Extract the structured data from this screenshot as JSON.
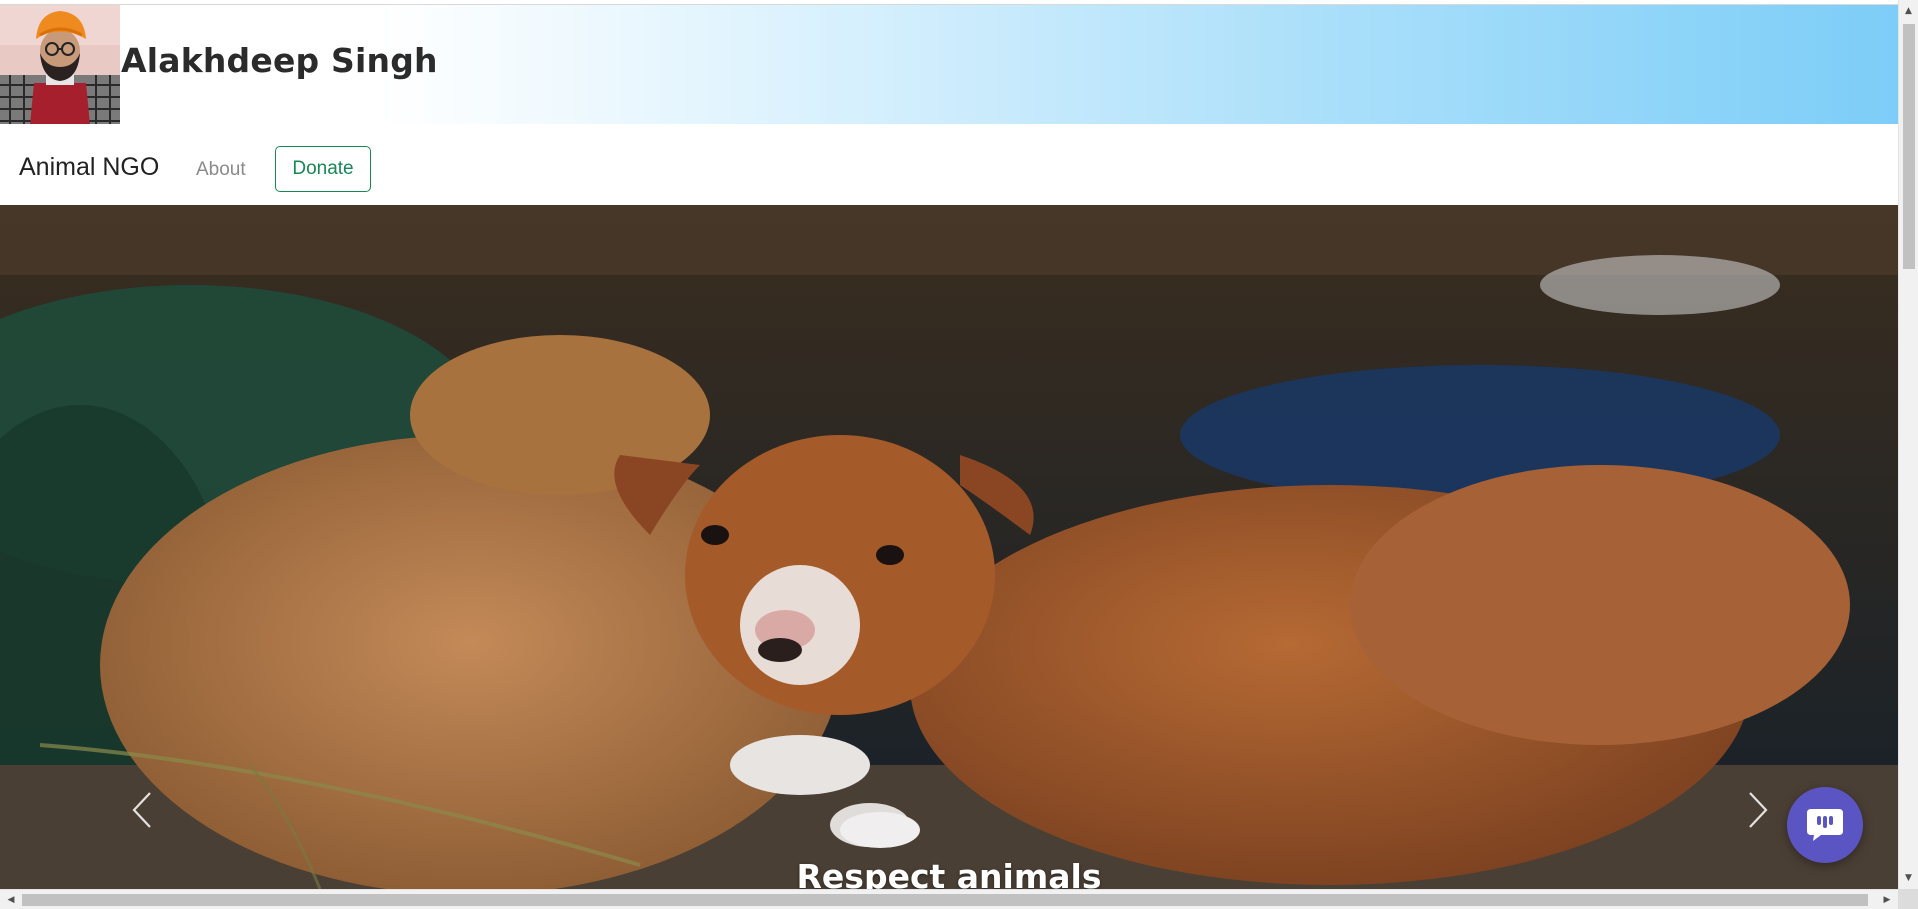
{
  "header": {
    "title": "Alakhdeep Singh",
    "avatar_icon": "profile-photo"
  },
  "navbar": {
    "brand": "Animal NGO",
    "links": [
      {
        "label": "About"
      }
    ],
    "donate_label": "Donate",
    "accent_color": "#198754"
  },
  "carousel": {
    "caption": "Respect animals",
    "prev_icon": "chevron-left-icon",
    "next_icon": "chevron-right-icon"
  },
  "chat_widget": {
    "icon": "chat-bubble-icon",
    "color": "#5b55c4"
  }
}
